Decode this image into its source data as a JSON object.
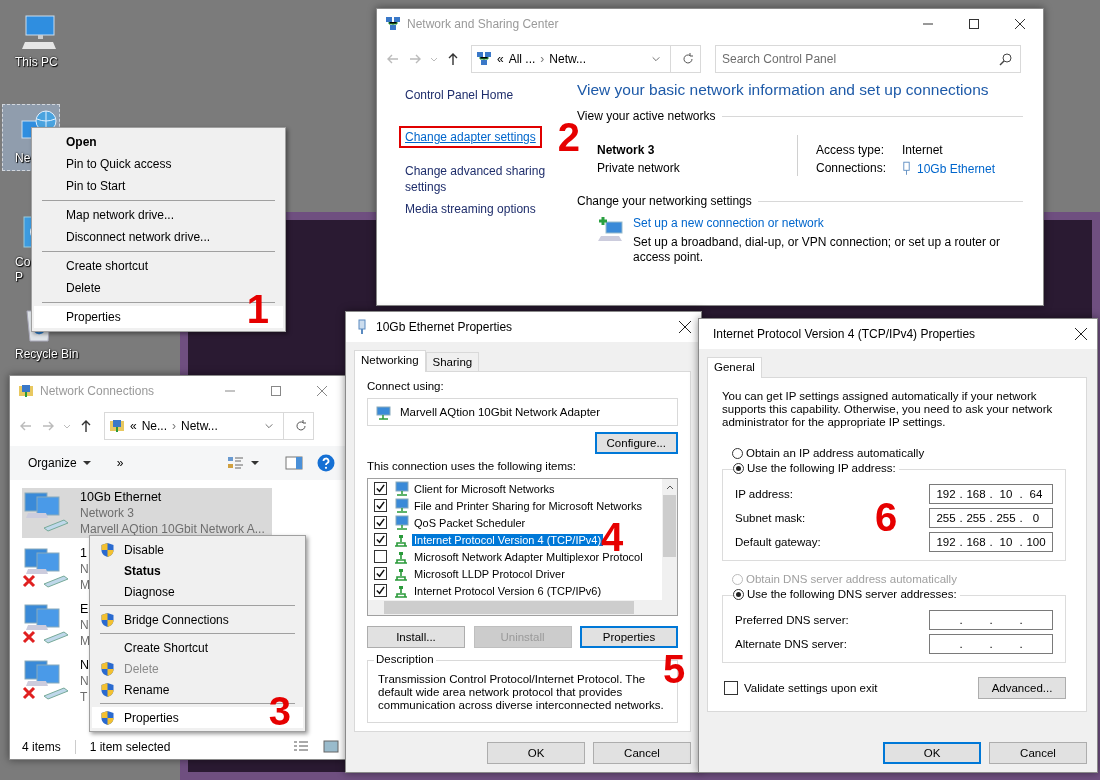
{
  "desktop": {
    "icons": [
      {
        "kind": "computer",
        "label_lines": [
          "This PC"
        ],
        "selected": false
      },
      {
        "kind": "network",
        "label_lines": [
          "Ne"
        ],
        "selected": true
      },
      {
        "kind": "control-panel",
        "label_lines": [
          "Co",
          "P"
        ],
        "selected": false
      },
      {
        "kind": "recycle-bin",
        "label_lines": [
          "Recycle Bin"
        ],
        "selected": false
      }
    ]
  },
  "desktop_menu": {
    "annotation": "1",
    "groups": [
      [
        {
          "label": "Open",
          "default": true,
          "selected": false
        },
        {
          "label": "Pin to Quick access",
          "default": false,
          "selected": false
        },
        {
          "label": "Pin to Start",
          "default": false,
          "selected": false
        }
      ],
      [
        {
          "label": "Map network drive...",
          "default": false,
          "selected": false
        },
        {
          "label": "Disconnect network drive...",
          "default": false,
          "selected": false
        }
      ],
      [
        {
          "label": "Create shortcut",
          "default": false,
          "selected": false
        },
        {
          "label": "Delete",
          "default": false,
          "selected": false
        }
      ],
      [
        {
          "label": "Properties",
          "default": false,
          "selected": true
        }
      ]
    ]
  },
  "sharing_center": {
    "window": {
      "title": "Network and Sharing Center",
      "active": false
    },
    "address": {
      "prefix": "«",
      "separator": "›",
      "crumbs": [
        "All ...",
        "Netw..."
      ]
    },
    "search": {
      "placeholder": "Search Control Panel"
    },
    "sidebar": [
      {
        "label": "Control Panel Home",
        "highlighted": false
      },
      {
        "label": "Change adapter settings",
        "highlighted": true
      },
      {
        "label": "Change advanced sharing settings",
        "highlighted": false
      },
      {
        "label": "Media streaming options",
        "highlighted": false
      }
    ],
    "annotation": "2",
    "heading": "View your basic network information and set up connections",
    "active_networks": {
      "title": "View your active networks",
      "name": "Network 3",
      "category": "Private network",
      "access_type_label": "Access type:",
      "access_type": "Internet",
      "connections_label": "Connections:",
      "connection": "10Gb Ethernet"
    },
    "settings": {
      "title": "Change your networking settings",
      "task": "Set up a new connection or network",
      "task_description": "Set up a broadband, dial-up, or VPN connection; or set up a router or access point."
    }
  },
  "connections": {
    "window": {
      "title": "Network Connections",
      "active": false
    },
    "address": {
      "prefix": "«",
      "separator": "›",
      "crumbs": [
        "Ne...",
        "Netw..."
      ]
    },
    "toolbar": {
      "organize": "Organize",
      "more": "»"
    },
    "items": [
      {
        "lines": [
          "10Gb Ethernet",
          "Network 3",
          "Marvell AQtion 10Gbit Network A..."
        ],
        "selected": true,
        "disconnected": false
      },
      {
        "lines": [
          "1",
          "N",
          "M"
        ],
        "selected": false,
        "disconnected": true
      },
      {
        "lines": [
          "E",
          "N",
          "M"
        ],
        "selected": false,
        "disconnected": true
      },
      {
        "lines": [
          "N",
          "N",
          "T"
        ],
        "selected": false,
        "disconnected": true
      }
    ],
    "status": [
      "4 items",
      "1 item selected"
    ]
  },
  "adapter_menu": {
    "annotation": "3",
    "groups": [
      [
        {
          "label": "Disable",
          "shield": true,
          "default": false,
          "disabled": false,
          "selected": false
        },
        {
          "label": "Status",
          "shield": false,
          "default": true,
          "disabled": false,
          "selected": false
        },
        {
          "label": "Diagnose",
          "shield": false,
          "default": false,
          "disabled": false,
          "selected": false
        }
      ],
      [
        {
          "label": "Bridge Connections",
          "shield": true,
          "default": false,
          "disabled": false,
          "selected": false
        }
      ],
      [
        {
          "label": "Create Shortcut",
          "shield": false,
          "default": false,
          "disabled": false,
          "selected": false
        },
        {
          "label": "Delete",
          "shield": true,
          "default": false,
          "disabled": true,
          "selected": false
        },
        {
          "label": "Rename",
          "shield": true,
          "default": false,
          "disabled": false,
          "selected": false
        }
      ],
      [
        {
          "label": "Properties",
          "shield": true,
          "default": false,
          "disabled": false,
          "selected": true
        }
      ]
    ]
  },
  "ethernet_properties": {
    "window": {
      "title": "10Gb Ethernet Properties",
      "active": true
    },
    "tabs": [
      {
        "label": "Networking",
        "selected": true
      },
      {
        "label": "Sharing",
        "selected": false
      }
    ],
    "connect_using_label": "Connect using:",
    "adapter": "Marvell AQtion 10Gbit Network Adapter",
    "configure": {
      "label": "Configure...",
      "focused": true
    },
    "items_label": "This connection uses the following items:",
    "items": [
      {
        "kind": "client",
        "label": "Client for Microsoft Networks",
        "checked": true,
        "selected": false
      },
      {
        "kind": "service",
        "label": "File and Printer Sharing for Microsoft Networks",
        "checked": true,
        "selected": false
      },
      {
        "kind": "service",
        "label": "QoS Packet Scheduler",
        "checked": true,
        "selected": false
      },
      {
        "kind": "protocol",
        "label": "Internet Protocol Version 4 (TCP/IPv4)",
        "checked": true,
        "selected": true
      },
      {
        "kind": "protocol",
        "label": "Microsoft Network Adapter Multiplexor Protocol",
        "checked": false,
        "selected": false
      },
      {
        "kind": "protocol",
        "label": "Microsoft LLDP Protocol Driver",
        "checked": true,
        "selected": false
      },
      {
        "kind": "protocol",
        "label": "Internet Protocol Version 6 (TCP/IPv6)",
        "checked": true,
        "selected": false
      }
    ],
    "buttons": [
      {
        "label": "Install...",
        "disabled": false,
        "focused": false
      },
      {
        "label": "Uninstall",
        "disabled": true,
        "focused": false
      },
      {
        "label": "Properties",
        "disabled": false,
        "focused": true
      }
    ],
    "annotations": [
      "4",
      "5"
    ],
    "description_label": "Description",
    "description": "Transmission Control Protocol/Internet Protocol. The default wide area network protocol that provides communication across diverse interconnected networks.",
    "footer": [
      {
        "label": "OK",
        "focused": false
      },
      {
        "label": "Cancel",
        "focused": false
      }
    ]
  },
  "ipv4_properties": {
    "window": {
      "title": "Internet Protocol Version 4 (TCP/IPv4) Properties",
      "active": true
    },
    "tabs": [
      {
        "label": "General",
        "selected": true
      }
    ],
    "intro": "You can get IP settings assigned automatically if your network supports this capability. Otherwise, you need to ask your network administrator for the appropriate IP settings.",
    "separator": ".",
    "annotation": "6",
    "ip": {
      "options": [
        {
          "label": "Obtain an IP address automatically",
          "selected": false,
          "disabled": false
        },
        {
          "label": "Use the following IP address:",
          "selected": true,
          "disabled": false
        }
      ],
      "fields": [
        {
          "label": "IP address:",
          "octets": [
            "192",
            "168",
            "10",
            "64"
          ]
        },
        {
          "label": "Subnet mask:",
          "octets": [
            "255",
            "255",
            "255",
            "0"
          ]
        },
        {
          "label": "Default gateway:",
          "octets": [
            "192",
            "168",
            "10",
            "100"
          ]
        }
      ]
    },
    "dns": {
      "options": [
        {
          "label": "Obtain DNS server address automatically",
          "selected": false,
          "disabled": true
        },
        {
          "label": "Use the following DNS server addresses:",
          "selected": true,
          "disabled": false
        }
      ],
      "fields": [
        {
          "label": "Preferred DNS server:"
        },
        {
          "label": "Alternate DNS server:"
        }
      ]
    },
    "validate": {
      "label": "Validate settings upon exit",
      "checked": false
    },
    "advanced": "Advanced...",
    "footer": [
      {
        "label": "OK",
        "focused": true
      },
      {
        "label": "Cancel",
        "focused": false
      }
    ]
  }
}
